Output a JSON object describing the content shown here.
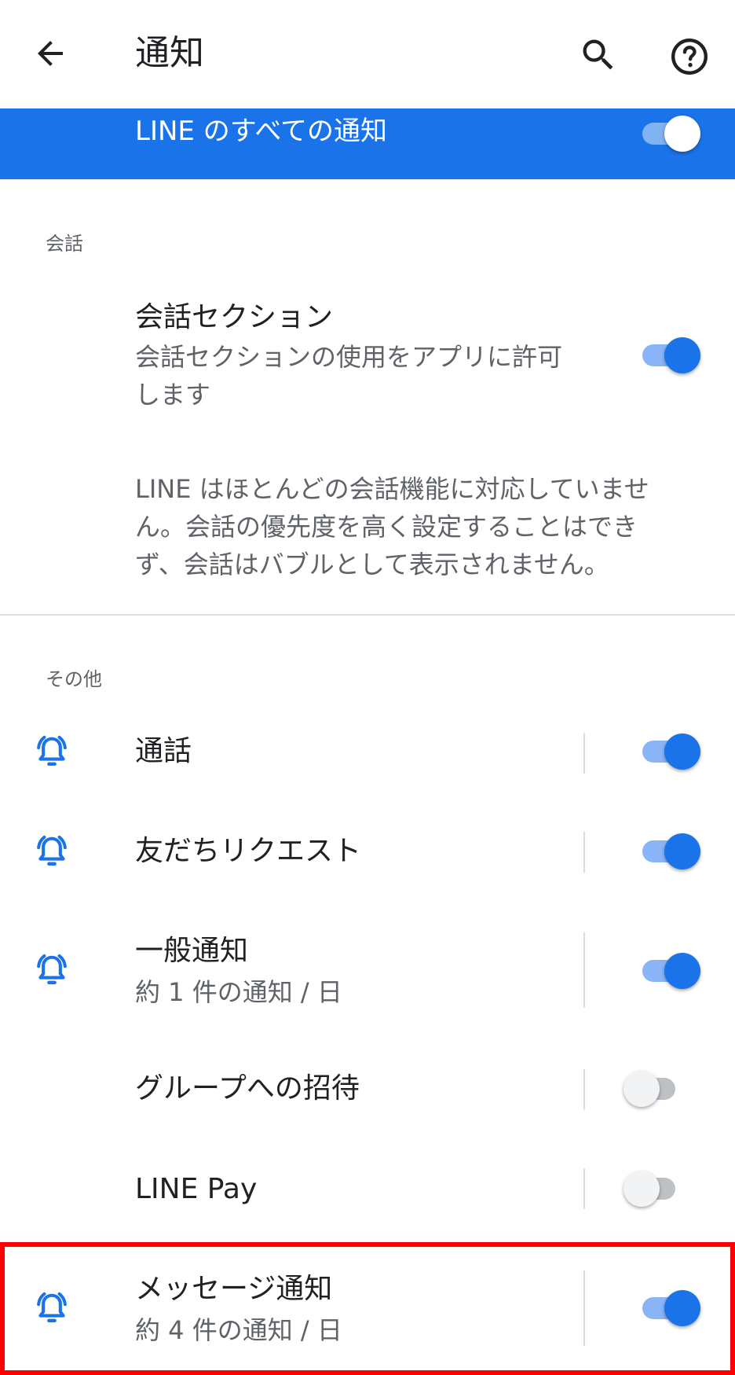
{
  "app_bar": {
    "title": "通知",
    "icons": {
      "back": "arrow-back-icon",
      "search": "search-icon",
      "help": "help-circle-icon"
    }
  },
  "master": {
    "label": "LINE のすべての通知",
    "enabled": true
  },
  "sections": {
    "conversation": {
      "header": "会話",
      "toggle_title": "会話セクション",
      "toggle_sub_line1": "会話セクションの使用をアプリに許可",
      "toggle_sub_line2": "します",
      "toggle_enabled": true,
      "note_line1": "LINE はほとんどの会話機能に対応していませ",
      "note_line2": "ん。会話の優先度を高く設定することはでき",
      "note_line3": "ず、会話はバブルとして表示されません。"
    },
    "other": {
      "header": "その他",
      "items": [
        {
          "title": "通話",
          "sub": "",
          "bell": true,
          "enabled": true
        },
        {
          "title": "友だちリクエスト",
          "sub": "",
          "bell": true,
          "enabled": true
        },
        {
          "title": "一般通知",
          "sub": "約 1 件の通知 / 日",
          "bell": true,
          "enabled": true
        },
        {
          "title": "グループへの招待",
          "sub": "",
          "bell": false,
          "enabled": false
        },
        {
          "title": "LINE Pay",
          "sub": "",
          "bell": false,
          "enabled": false
        },
        {
          "title": "メッセージ通知",
          "sub": "約 4 件の通知 / 日",
          "bell": true,
          "enabled": true
        }
      ]
    }
  },
  "colors": {
    "accent": "#1a73e8",
    "highlight": "#ff0000"
  }
}
